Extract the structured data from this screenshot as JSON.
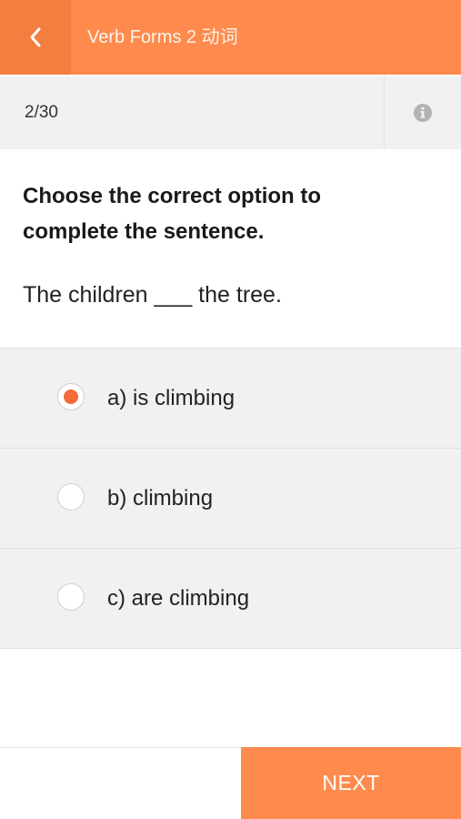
{
  "header": {
    "title": "Verb Forms 2 动词",
    "back_icon": "chevron-left-icon",
    "color": "#fe8b4d"
  },
  "progress": {
    "text": "2/30",
    "info_icon": "info-icon"
  },
  "question": {
    "instruction": "Choose the correct option to complete the sentence.",
    "sentence": "The children ___ the tree."
  },
  "options": [
    {
      "label": "a)  is climbing",
      "selected": true
    },
    {
      "label": "b)  climbing",
      "selected": false
    },
    {
      "label": "c)  are climbing",
      "selected": false
    }
  ],
  "footer": {
    "next_label": "NEXT"
  },
  "colors": {
    "accent": "#fe8b4d",
    "selected_radio": "#f26b3a"
  }
}
